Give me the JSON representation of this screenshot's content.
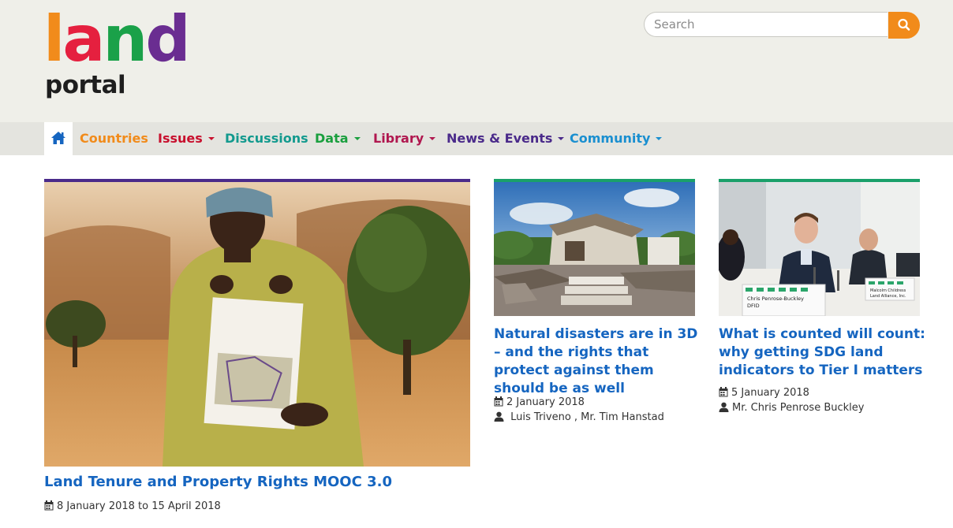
{
  "brand": {
    "logo_letters": [
      "l",
      "a",
      "n",
      "d"
    ],
    "logo_colors": [
      "#f18b1b",
      "#e5203f",
      "#1aa149",
      "#6a2d91"
    ],
    "logo_sub": "portal"
  },
  "search": {
    "placeholder": "Search",
    "button_icon": "search-icon",
    "accent": "#f18b1b"
  },
  "nav": {
    "home_icon": "home-icon",
    "items": [
      {
        "label": "Countries",
        "color": "#f18b1b",
        "dropdown": false
      },
      {
        "label": "Issues",
        "color": "#c8102e",
        "dropdown": true
      },
      {
        "label": "Discussions",
        "color": "#139a8e",
        "dropdown": false
      },
      {
        "label": "Data",
        "color": "#1a9f3e",
        "dropdown": true
      },
      {
        "label": "Library",
        "color": "#b0174f",
        "dropdown": true
      },
      {
        "label": "News & Events",
        "color": "#4a2a8a",
        "dropdown": true
      },
      {
        "label": "Community",
        "color": "#1a8fd0",
        "dropdown": true
      }
    ]
  },
  "featured": {
    "accent": "#4a2a8a",
    "title": "Land Tenure and Property Rights MOOC 3.0",
    "date": "8 January 2018 to 15 April 2018"
  },
  "cards": [
    {
      "accent": "#1aa06a",
      "title_lines": [
        "Natural disasters are in 3D",
        "– and the rights that",
        "protect against them",
        "should be as well"
      ],
      "date": "2 January 2018",
      "author": "Luis Triveno , Mr. Tim Hanstad"
    },
    {
      "accent": "#1aa06a",
      "title_lines": [
        "What is counted will count:",
        "why getting SDG land",
        "indicators to Tier I matters"
      ],
      "date": "5 January 2018",
      "author": "Mr. Chris Penrose Buckley",
      "photo_placards": [
        "Chris Penrose-Buckley",
        "DFID",
        "Malcolm Childress",
        "Land Alliance, Inc."
      ]
    }
  ]
}
